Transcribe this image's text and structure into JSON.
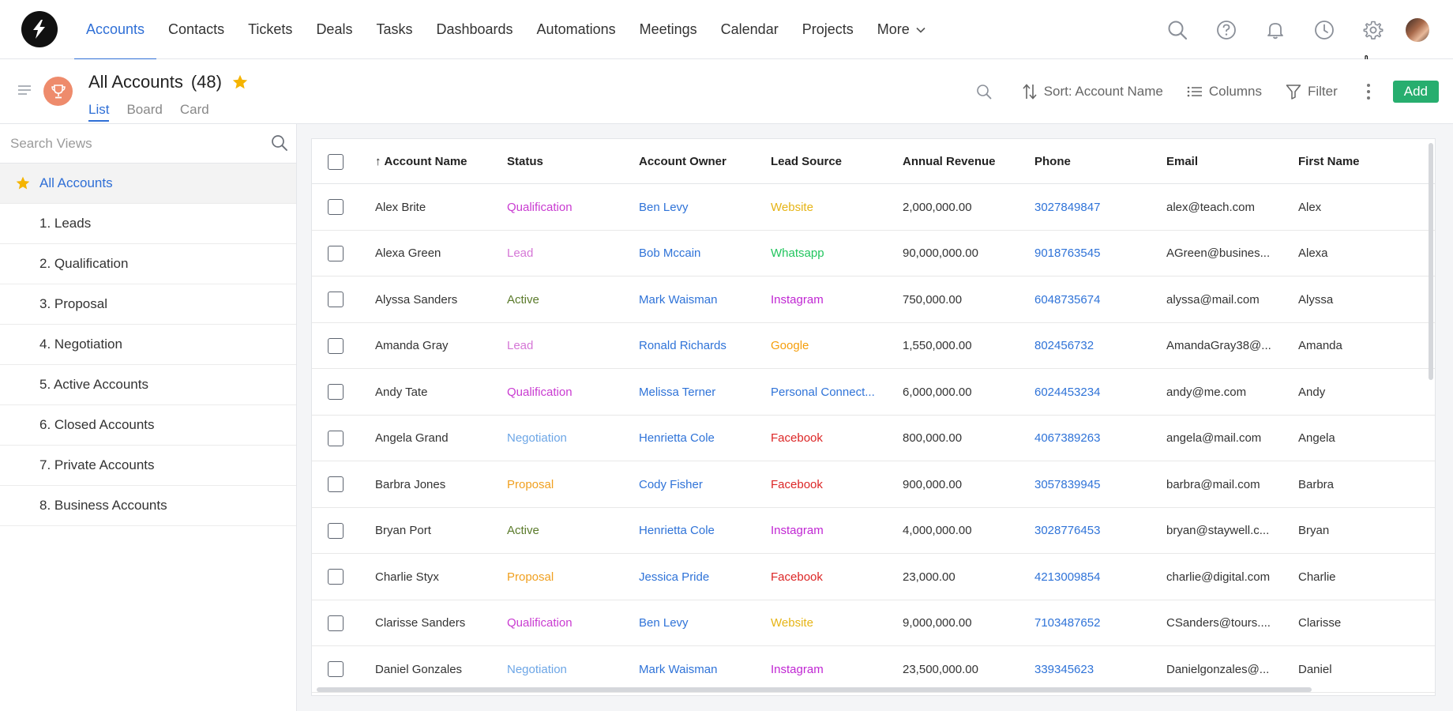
{
  "nav": {
    "items": [
      {
        "label": "Accounts",
        "active": true
      },
      {
        "label": "Contacts"
      },
      {
        "label": "Tickets"
      },
      {
        "label": "Deals"
      },
      {
        "label": "Tasks"
      },
      {
        "label": "Dashboards"
      },
      {
        "label": "Automations"
      },
      {
        "label": "Meetings"
      },
      {
        "label": "Calendar"
      },
      {
        "label": "Projects"
      }
    ],
    "more_label": "More"
  },
  "header": {
    "title": "All Accounts",
    "count": "(48)",
    "tabs": [
      {
        "label": "List",
        "active": true
      },
      {
        "label": "Board"
      },
      {
        "label": "Card"
      }
    ],
    "sort_label": "Sort: Account Name",
    "columns_label": "Columns",
    "filter_label": "Filter",
    "add_label": "Add"
  },
  "sidebar": {
    "search_placeholder": "Search Views",
    "views": [
      {
        "label": "All Accounts",
        "active": true
      },
      {
        "label": "1. Leads"
      },
      {
        "label": "2. Qualification"
      },
      {
        "label": "3. Proposal"
      },
      {
        "label": "4. Negotiation"
      },
      {
        "label": "5. Active Accounts"
      },
      {
        "label": "6. Closed Accounts"
      },
      {
        "label": "7. Private Accounts"
      },
      {
        "label": "8. Business Accounts"
      }
    ]
  },
  "table": {
    "sort_arrow": "↑",
    "columns": [
      "Account Name",
      "Status",
      "Account Owner",
      "Lead Source",
      "Annual Revenue",
      "Phone",
      "Email",
      "First Name"
    ],
    "status_colors": {
      "Qualification": "#c93bd1",
      "Lead": "#d576d6",
      "Active": "#5a7a2a",
      "Negotiation": "#6da6e6",
      "Proposal": "#f0a020"
    },
    "source_colors": {
      "Website": "#e6b415",
      "Whatsapp": "#22c55e",
      "Instagram": "#c026d3",
      "Google": "#f59e0b",
      "Personal Connect...": "#2f73d8",
      "Facebook": "#dc2626"
    },
    "rows": [
      {
        "name": "Alex Brite",
        "status": "Qualification",
        "owner": "Ben Levy",
        "source": "Website",
        "revenue": "2,000,000.00",
        "phone": "3027849847",
        "email": "alex@teach.com",
        "first": "Alex"
      },
      {
        "name": "Alexa Green",
        "status": "Lead",
        "owner": "Bob Mccain",
        "source": "Whatsapp",
        "revenue": "90,000,000.00",
        "phone": "9018763545",
        "email": "AGreen@busines...",
        "first": "Alexa"
      },
      {
        "name": "Alyssa Sanders",
        "status": "Active",
        "owner": "Mark Waisman",
        "source": "Instagram",
        "revenue": "750,000.00",
        "phone": "6048735674",
        "email": "alyssa@mail.com",
        "first": "Alyssa"
      },
      {
        "name": "Amanda Gray",
        "status": "Lead",
        "owner": "Ronald Richards",
        "source": "Google",
        "revenue": "1,550,000.00",
        "phone": "802456732",
        "email": "AmandaGray38@...",
        "first": "Amanda"
      },
      {
        "name": "Andy Tate",
        "status": "Qualification",
        "owner": "Melissa Terner",
        "source": "Personal Connect...",
        "revenue": "6,000,000.00",
        "phone": "6024453234",
        "email": "andy@me.com",
        "first": "Andy"
      },
      {
        "name": "Angela Grand",
        "status": "Negotiation",
        "owner": "Henrietta Cole",
        "source": "Facebook",
        "revenue": "800,000.00",
        "phone": "4067389263",
        "email": "angela@mail.com",
        "first": "Angela"
      },
      {
        "name": "Barbra Jones",
        "status": "Proposal",
        "owner": "Cody Fisher",
        "source": "Facebook",
        "revenue": "900,000.00",
        "phone": "3057839945",
        "email": "barbra@mail.com",
        "first": "Barbra"
      },
      {
        "name": "Bryan Port",
        "status": "Active",
        "owner": "Henrietta Cole",
        "source": "Instagram",
        "revenue": "4,000,000.00",
        "phone": "3028776453",
        "email": "bryan@staywell.c...",
        "first": "Bryan"
      },
      {
        "name": "Charlie Styx",
        "status": "Proposal",
        "owner": "Jessica Pride",
        "source": "Facebook",
        "revenue": "23,000.00",
        "phone": "4213009854",
        "email": "charlie@digital.com",
        "first": "Charlie"
      },
      {
        "name": "Clarisse Sanders",
        "status": "Qualification",
        "owner": "Ben Levy",
        "source": "Website",
        "revenue": "9,000,000.00",
        "phone": "7103487652",
        "email": "CSanders@tours....",
        "first": "Clarisse"
      },
      {
        "name": "Daniel Gonzales",
        "status": "Negotiation",
        "owner": "Mark Waisman",
        "source": "Instagram",
        "revenue": "23,500,000.00",
        "phone": "339345623",
        "email": "Danielgonzales@...",
        "first": "Daniel"
      }
    ]
  },
  "colors": {
    "accent": "#2f6fd6",
    "add_button": "#27ae6f",
    "star": "#f5b400",
    "trophy_bg": "#ee8b6c"
  }
}
